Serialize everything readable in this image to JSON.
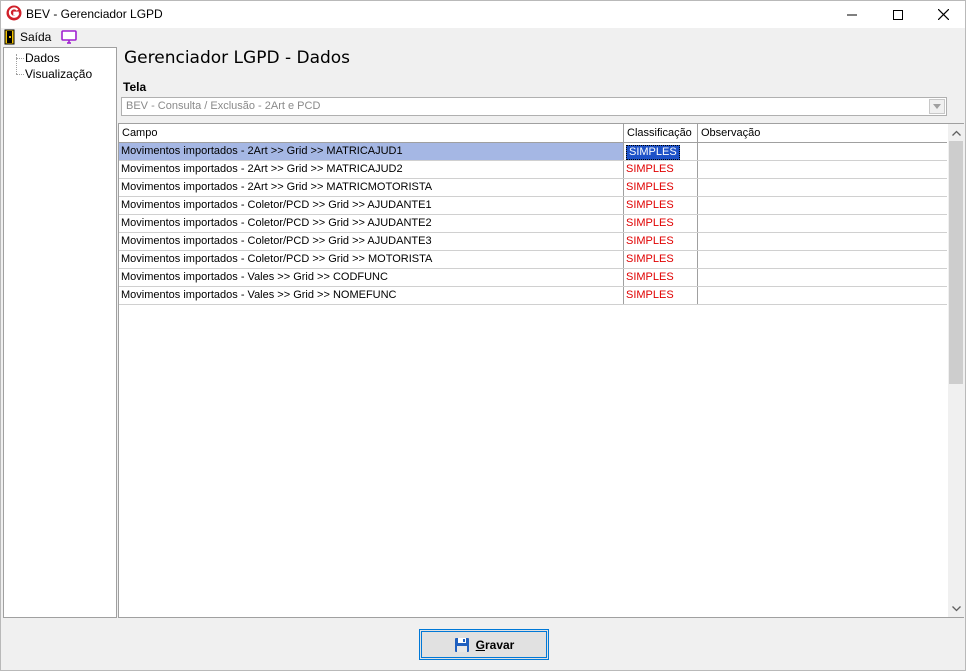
{
  "window": {
    "title": "BEV - Gerenciador LGPD"
  },
  "menu": {
    "exit_label": "Saída",
    "icons": [
      "door-exit-icon",
      "monitor-icon"
    ]
  },
  "tree": {
    "items": [
      {
        "label": "Dados"
      },
      {
        "label": "Visualização"
      }
    ]
  },
  "page": {
    "title": "Gerenciador LGPD - Dados",
    "tela_label": "Tela",
    "tela_value": "BEV - Consulta / Exclusão - 2Art e PCD"
  },
  "grid": {
    "columns": [
      "Campo",
      "Classificação",
      "Observação"
    ],
    "rows": [
      {
        "campo": "Movimentos importados - 2Art >> Grid >> MATRICAJUD1",
        "classificacao": "SIMPLES",
        "observacao": ""
      },
      {
        "campo": "Movimentos importados - 2Art >> Grid >> MATRICAJUD2",
        "classificacao": "SIMPLES",
        "observacao": ""
      },
      {
        "campo": "Movimentos importados - 2Art >> Grid >> MATRICMOTORISTA",
        "classificacao": "SIMPLES",
        "observacao": ""
      },
      {
        "campo": "Movimentos importados - Coletor/PCD >> Grid >> AJUDANTE1",
        "classificacao": "SIMPLES",
        "observacao": ""
      },
      {
        "campo": "Movimentos importados - Coletor/PCD >> Grid >> AJUDANTE2",
        "classificacao": "SIMPLES",
        "observacao": ""
      },
      {
        "campo": "Movimentos importados - Coletor/PCD >> Grid >> AJUDANTE3",
        "classificacao": "SIMPLES",
        "observacao": ""
      },
      {
        "campo": "Movimentos importados - Coletor/PCD >> Grid >> MOTORISTA",
        "classificacao": "SIMPLES",
        "observacao": ""
      },
      {
        "campo": "Movimentos importados - Vales >> Grid >> CODFUNC",
        "classificacao": "SIMPLES",
        "observacao": ""
      },
      {
        "campo": "Movimentos importados - Vales >> Grid >> NOMEFUNC",
        "classificacao": "SIMPLES",
        "observacao": ""
      }
    ],
    "selected_row": 0
  },
  "footer": {
    "save_label": "Gravar"
  },
  "colors": {
    "selection": "#a5b7e4",
    "classification_text": "#e00000",
    "focus_border": "#0078d7"
  }
}
